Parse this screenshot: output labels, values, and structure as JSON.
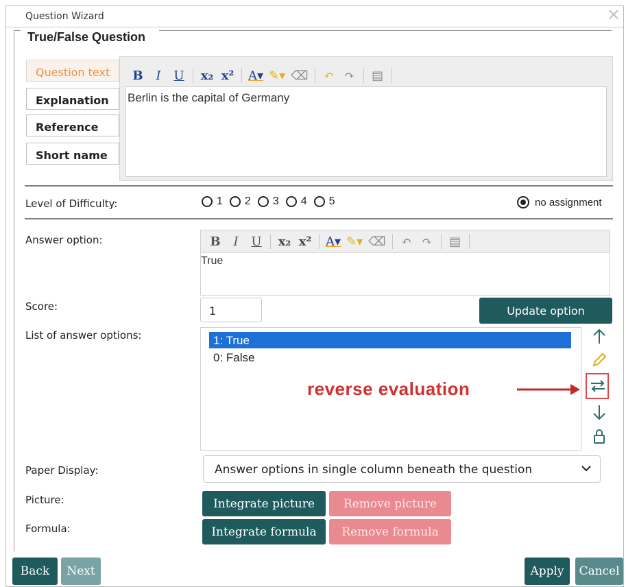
{
  "window": {
    "title": "Question Wizard",
    "close_icon": "close-icon"
  },
  "group": {
    "title": "True/False Question"
  },
  "tabs": [
    {
      "label": "Question text",
      "active": true
    },
    {
      "label": "Explanation",
      "active": false
    },
    {
      "label": "Reference",
      "active": false
    },
    {
      "label": "Short name",
      "active": false
    }
  ],
  "editor": {
    "toolbar": [
      "bold-icon",
      "italic-icon",
      "underline-icon",
      "subscript-icon",
      "superscript-icon",
      "font-color-icon",
      "highlight-icon",
      "clear-format-icon",
      "undo-icon",
      "redo-icon",
      "paste-icon"
    ],
    "content": "Berlin is the capital of Germany"
  },
  "difficulty": {
    "label": "Level of Difficulty:",
    "options": [
      "1",
      "2",
      "3",
      "4",
      "5"
    ],
    "no_assignment_label": "no assignment",
    "selected": "no assignment"
  },
  "answer_option": {
    "label": "Answer option:",
    "content": "True"
  },
  "score": {
    "label": "Score:",
    "value": "1",
    "update_button": "Update option"
  },
  "answer_list": {
    "label": "List of answer options:",
    "items": [
      {
        "text": "1: True",
        "selected": true
      },
      {
        "text": "0: False",
        "selected": false
      }
    ],
    "side_icons": [
      "arrow-up-icon",
      "pencil-icon",
      "reverse-evaluation-icon",
      "arrow-down-icon",
      "lock-icon"
    ]
  },
  "annotation": {
    "text": "reverse evaluation",
    "color": "#d32f2f"
  },
  "paper_display": {
    "label": "Paper Display:",
    "value": "Answer options in single column beneath the question"
  },
  "picture": {
    "label": "Picture:",
    "integrate": "Integrate picture",
    "remove": "Remove picture"
  },
  "formula": {
    "label": "Formula:",
    "integrate": "Integrate formula",
    "remove": "Remove formula"
  },
  "footer": {
    "back": "Back",
    "next": "Next",
    "apply": "Apply",
    "cancel": "Cancel"
  },
  "colors": {
    "primary": "#1f5a5c",
    "disabled_primary": "#7aa3a4",
    "danger_light": "#e88a90",
    "selection": "#1e6fd6",
    "active_tab": "#e8924a"
  }
}
